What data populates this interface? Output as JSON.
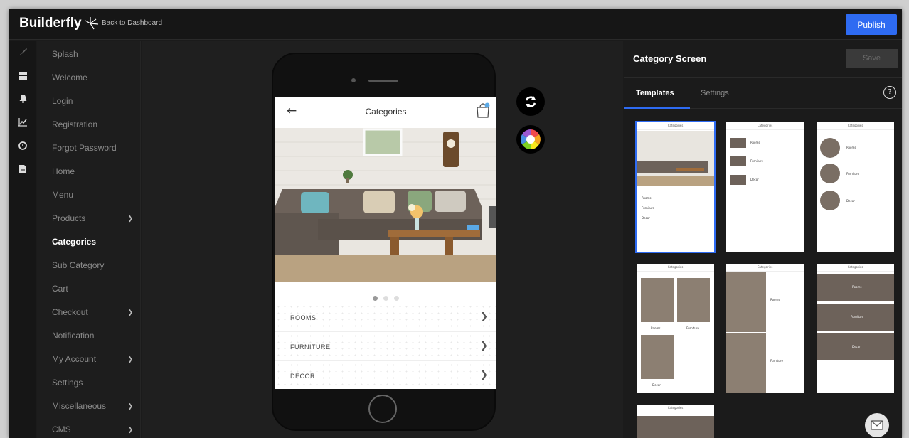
{
  "header": {
    "logo": "Builderfly",
    "back_link": "Back to Dashboard",
    "publish": "Publish"
  },
  "menu": {
    "items": [
      {
        "label": "Splash"
      },
      {
        "label": "Welcome"
      },
      {
        "label": "Login"
      },
      {
        "label": "Registration"
      },
      {
        "label": "Forgot Password"
      },
      {
        "label": "Home"
      },
      {
        "label": "Menu"
      },
      {
        "label": "Products"
      },
      {
        "label": "Categories"
      },
      {
        "label": "Sub Category"
      },
      {
        "label": "Cart"
      },
      {
        "label": "Checkout"
      },
      {
        "label": "Notification"
      },
      {
        "label": "My Account"
      },
      {
        "label": "Settings"
      },
      {
        "label": "Miscellaneous"
      },
      {
        "label": "CMS"
      }
    ]
  },
  "preview": {
    "screen_title": "Categories",
    "categories": [
      {
        "label": "ROOMS"
      },
      {
        "label": "FURNITURE"
      },
      {
        "label": "DECOR"
      }
    ]
  },
  "panel": {
    "title": "Category Screen",
    "save": "Save",
    "tabs": [
      {
        "label": "Templates"
      },
      {
        "label": "Settings"
      }
    ],
    "help": "?"
  },
  "templates": {
    "mini_title": "Categories",
    "rows": [
      "Rooms",
      "Furniture",
      "Decor"
    ]
  },
  "colors": {
    "accent": "#2e6bf2",
    "background": "#1b1b1b"
  }
}
